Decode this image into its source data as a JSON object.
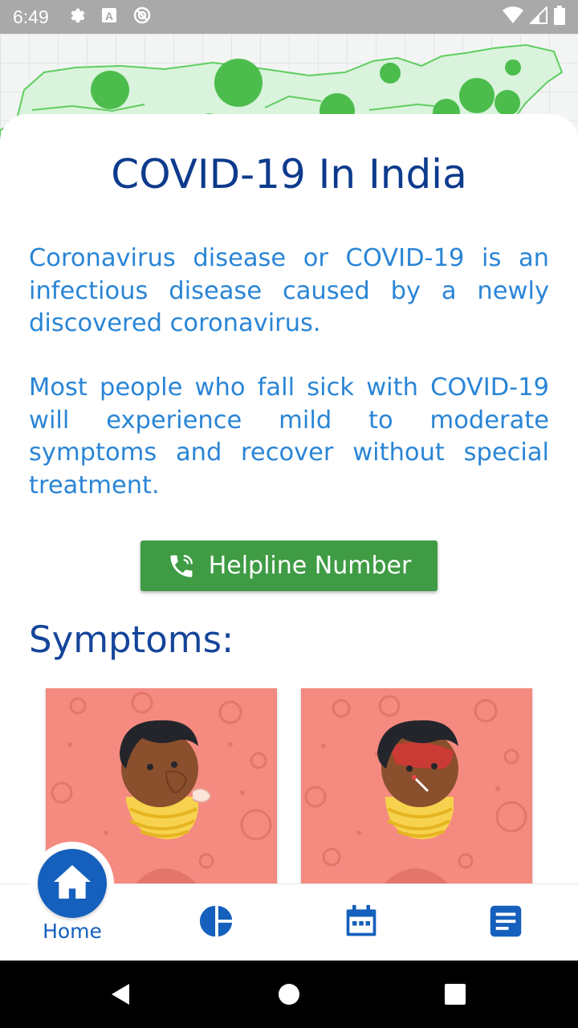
{
  "status_bar": {
    "time": "6:49",
    "icons_left": [
      "settings-icon",
      "a-notification-icon",
      "do-not-disturb-icon"
    ],
    "icons_right": [
      "wifi-icon",
      "signal-icon",
      "battery-icon"
    ]
  },
  "header": {
    "map": "india-map-illustration",
    "colors": {
      "map_fill": "#d9f3dc",
      "map_stroke": "#5fce5f",
      "dot": "#4cbd4c"
    }
  },
  "main": {
    "title": "COVID-19 In India",
    "paragraphs": [
      "Coronavirus disease or COVID-19 is an infectious disease caused by a newly discovered coronavirus.",
      "Most people who fall sick with COVID-19 will experience mild to moderate symptoms and recover without special treatment."
    ],
    "helpline_button": {
      "label": "Helpline Number",
      "icon": "phone-icon"
    },
    "symptoms_title": "Symptoms:",
    "symptom_cards": [
      {
        "image": "coughing-person-illustration"
      },
      {
        "image": "fever-person-illustration"
      }
    ],
    "colors": {
      "title": "#0d3b8c",
      "paragraph": "#2a85d6",
      "button": "#3f9c45",
      "card": "#f48a80"
    }
  },
  "bottom_nav": {
    "items": [
      {
        "label": "Home",
        "icon": "home-icon",
        "active": true
      },
      {
        "icon": "pie-chart-icon"
      },
      {
        "icon": "calendar-icon"
      },
      {
        "icon": "news-icon"
      }
    ],
    "active_color": "#1560bd"
  },
  "android_nav": {
    "buttons": [
      "back-icon",
      "home-circle-icon",
      "recents-icon"
    ]
  }
}
